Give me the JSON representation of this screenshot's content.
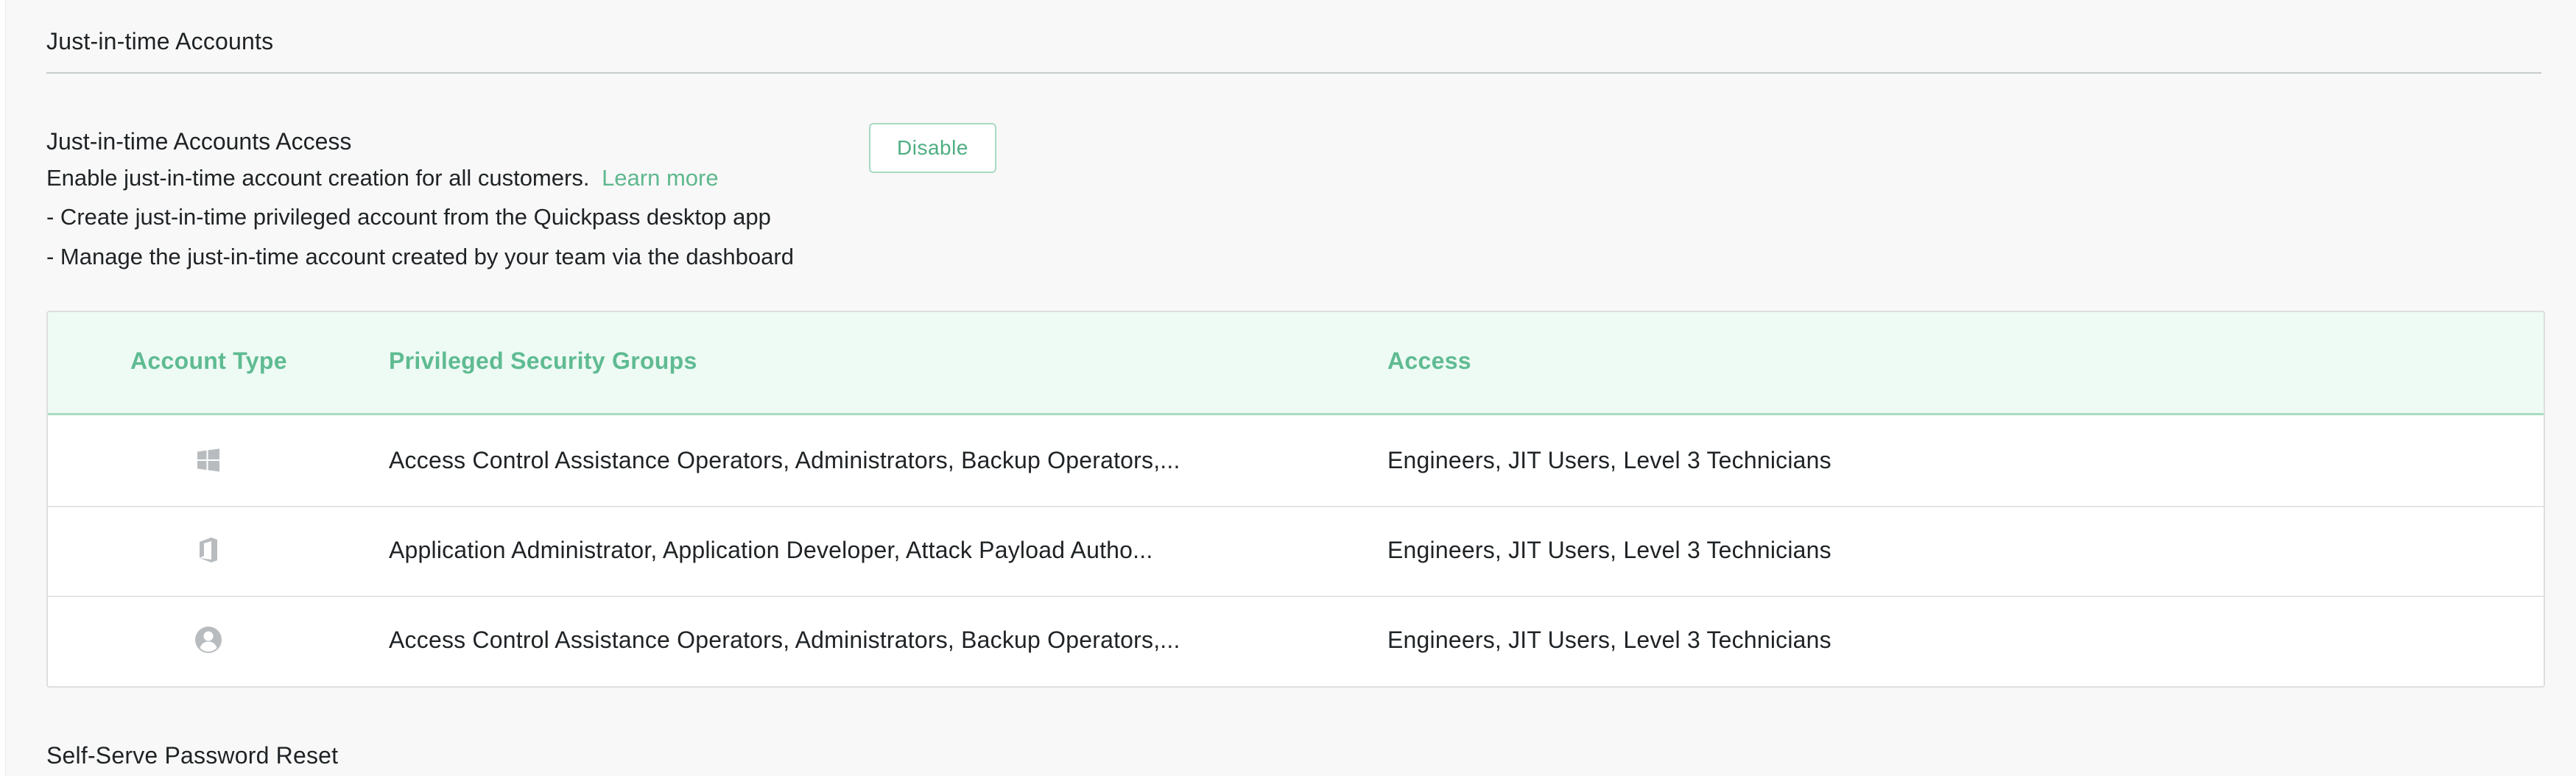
{
  "section": {
    "title": "Just-in-time Accounts"
  },
  "feature": {
    "title": "Just-in-time Accounts Access",
    "description": "Enable just-in-time account creation for all customers.",
    "learn_more": "Learn more",
    "bullets": [
      "- Create just-in-time privileged account from the Quickpass desktop app",
      "- Manage the just-in-time account created by your team via the dashboard"
    ],
    "disable_label": "Disable"
  },
  "table": {
    "headers": {
      "account_type": "Account Type",
      "groups": "Privileged Security Groups",
      "access": "Access"
    },
    "rows": [
      {
        "icon": "windows-icon",
        "groups": "Access Control Assistance Operators, Administrators, Backup Operators,...",
        "access": "Engineers, JIT Users, Level 3 Technicians"
      },
      {
        "icon": "office-icon",
        "groups": "Application Administrator, Application Developer, Attack Payload Autho...",
        "access": "Engineers, JIT Users, Level 3 Technicians"
      },
      {
        "icon": "user-circle-icon",
        "groups": "Access Control Assistance Operators, Administrators, Backup Operators,...",
        "access": "Engineers, JIT Users, Level 3 Technicians"
      }
    ]
  },
  "next_section": {
    "title": "Self-Serve Password Reset"
  },
  "colors": {
    "accent": "#5fbb92",
    "header_bg": "#eefaf4",
    "page_bg": "#f8f8f8",
    "icon_gray": "#b8bcbf"
  }
}
